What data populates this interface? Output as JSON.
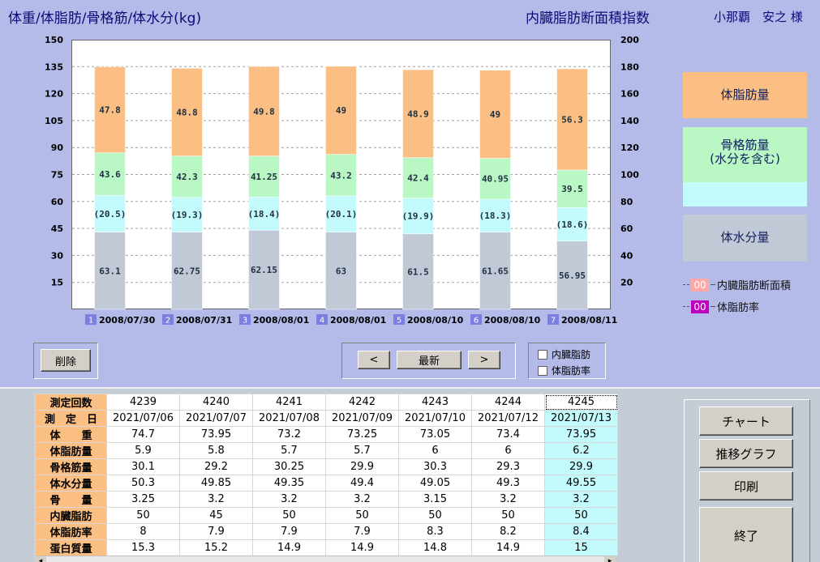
{
  "header": {
    "left_title": "体重/体脂肪/骨格筋/体水分(kg)",
    "center_title": "内臓脂肪断面積指数",
    "user": "小那覇　安之 様"
  },
  "legend": {
    "fat": "体脂肪量",
    "muscle_line1": "骨格筋量",
    "muscle_line2": "(水分を含む)",
    "water": "体水分量",
    "visceral_chip": "00",
    "visceral_label": "内臓脂肪断面積",
    "bodyfat_chip": "00",
    "bodyfat_label": "体脂肪率"
  },
  "controls": {
    "delete": "削除",
    "prev": "<",
    "latest": "最新",
    "next": ">",
    "chk_visceral": "内臓脂肪",
    "chk_bodyfat": "体脂肪率"
  },
  "side_buttons": {
    "chart": "チャート",
    "trend": "推移グラフ",
    "print": "印刷",
    "exit": "終了"
  },
  "colors": {
    "fat": "#fbbf84",
    "muscle": "#b9f7c5",
    "water_pct": "#c3fbfd",
    "water": "#c1c9d6",
    "index_chip": "#7b7fe0"
  },
  "chart_data": {
    "type": "bar",
    "stacked": true,
    "left_axis": {
      "min": 0,
      "max": 150,
      "ticks": [
        15,
        30,
        45,
        60,
        75,
        90,
        105,
        120,
        135,
        150
      ]
    },
    "right_axis": {
      "min": 0,
      "max": 200,
      "ticks": [
        20,
        40,
        60,
        80,
        100,
        120,
        140,
        160,
        180,
        200
      ]
    },
    "grid": true,
    "categories": [
      "2008/07/30",
      "2008/07/31",
      "2008/08/01",
      "2008/08/01",
      "2008/08/10",
      "2008/08/10",
      "2008/08/11"
    ],
    "index_labels": [
      "1",
      "2",
      "3",
      "4",
      "5",
      "6",
      "7"
    ],
    "series": [
      {
        "name": "体水分量",
        "values": [
          43,
          43,
          44,
          43,
          42,
          43,
          38
        ],
        "labels": [
          "63.1",
          "62.75",
          "62.15",
          "63",
          "61.5",
          "61.65",
          "56.95"
        ]
      },
      {
        "name": "",
        "values": [
          20.5,
          19.3,
          18.4,
          20.1,
          19.9,
          18.3,
          18.6
        ],
        "labels": [
          "(20.5)",
          "(19.3)",
          "(18.4)",
          "(20.1)",
          "(19.9)",
          "(18.3)",
          "(18.6)"
        ]
      },
      {
        "name": "骨格筋量",
        "values": [
          23.6,
          23,
          22.9,
          23.1,
          22.5,
          22.7,
          20.9
        ],
        "labels": [
          "43.6",
          "42.3",
          "41.25",
          "43.2",
          "42.4",
          "40.95",
          "39.5"
        ]
      },
      {
        "name": "体脂肪量",
        "values": [
          47.8,
          48.8,
          49.8,
          49,
          48.9,
          49,
          56.3
        ],
        "labels": [
          "47.8",
          "48.8",
          "49.8",
          "49",
          "48.9",
          "49",
          "56.3"
        ]
      }
    ]
  },
  "table": {
    "row_headers": [
      "測定回数",
      "測　定　日",
      "体　　重",
      "体脂肪量",
      "骨格筋量",
      "体水分量",
      "骨　　量",
      "内臓脂肪",
      "体脂肪率",
      "蛋白質量"
    ],
    "columns": [
      [
        "4239",
        "2021/07/06",
        "74.7",
        "5.9",
        "30.1",
        "50.3",
        "3.25",
        "50",
        "8",
        "15.3"
      ],
      [
        "4240",
        "2021/07/07",
        "73.95",
        "5.8",
        "29.2",
        "49.85",
        "3.2",
        "45",
        "7.9",
        "15.2"
      ],
      [
        "4241",
        "2021/07/08",
        "73.2",
        "5.7",
        "30.25",
        "49.35",
        "3.2",
        "50",
        "7.9",
        "14.9"
      ],
      [
        "4242",
        "2021/07/09",
        "73.25",
        "5.7",
        "29.9",
        "49.4",
        "3.2",
        "50",
        "7.9",
        "14.9"
      ],
      [
        "4243",
        "2021/07/10",
        "73.05",
        "6",
        "30.3",
        "49.05",
        "3.15",
        "50",
        "8.3",
        "14.8"
      ],
      [
        "4244",
        "2021/07/12",
        "73.4",
        "6",
        "29.3",
        "49.3",
        "3.2",
        "50",
        "8.2",
        "14.9"
      ],
      [
        "4245",
        "2021/07/13",
        "73.95",
        "6.2",
        "29.9",
        "49.55",
        "3.2",
        "50",
        "8.4",
        "15"
      ]
    ]
  },
  "scrollbar": {
    "left": "◂",
    "right": "▸"
  }
}
